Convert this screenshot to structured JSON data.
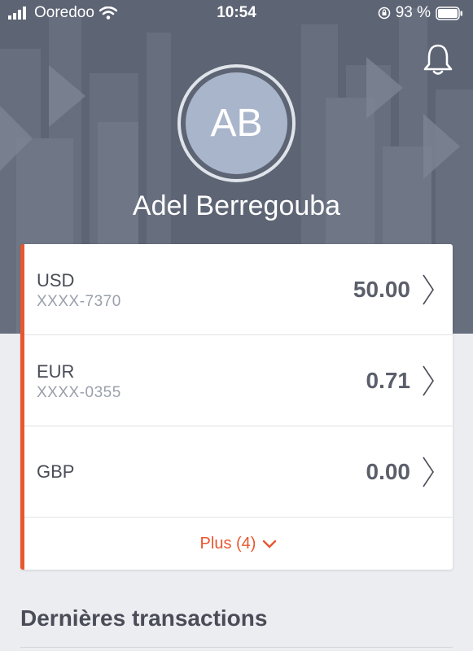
{
  "status_bar": {
    "carrier": "Ooredoo",
    "time": "10:54",
    "battery_percent": "93 %"
  },
  "profile": {
    "initials": "AB",
    "name": "Adel Berregouba"
  },
  "accounts": [
    {
      "currency": "USD",
      "number": "XXXX-7370",
      "balance": "50.00"
    },
    {
      "currency": "EUR",
      "number": "XXXX-0355",
      "balance": "0.71"
    },
    {
      "currency": "GBP",
      "number": "",
      "balance": "0.00"
    }
  ],
  "more_label": "Plus (4)",
  "transactions": {
    "title": "Dernières transactions"
  },
  "colors": {
    "accent": "#e8572f",
    "header_bg": "#5d6474",
    "avatar_bg": "#a9b5cb",
    "page_bg": "#ecedf1"
  },
  "icons": [
    "signal-icon",
    "wifi-icon",
    "orientation-lock-icon",
    "battery-icon",
    "bell-icon",
    "chevron-right-icon",
    "chevron-down-icon"
  ]
}
